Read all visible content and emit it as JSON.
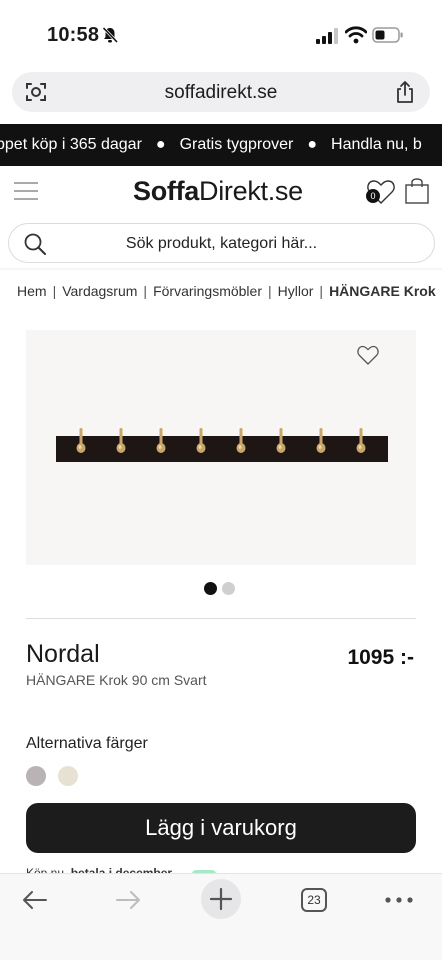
{
  "status_bar": {
    "time": "10:58"
  },
  "browser": {
    "url": "soffadirekt.se",
    "tab_count": "23"
  },
  "promo": {
    "items": [
      "ppet köp i 365 dagar",
      "Gratis tygprover",
      "Handla nu, b"
    ]
  },
  "header": {
    "logo_bold": "Soffa",
    "logo_rest": "Direkt.se",
    "wishlist_count": "0"
  },
  "search": {
    "placeholder": "Sök produkt, kategori här..."
  },
  "breadcrumb": [
    "Hem",
    "Vardagsrum",
    "Förvaringsmöbler",
    "Hyllor",
    "HÄNGARE Krok"
  ],
  "product": {
    "name": "Nordal",
    "subtitle": "HÄNGARE Krok 90 cm Svart",
    "price": "1095 :-",
    "alt_colors_label": "Alternativa färger",
    "swatches": [
      "#b9b3b5",
      "#e7e1d3"
    ],
    "add_to_cart_label": "Lägg i varukorg",
    "image_count": 2,
    "active_image": 1
  },
  "klarna": {
    "text": "Köp nu, ",
    "bold": "betala i december"
  },
  "colors": {
    "accent": "#1c1c1c",
    "promo_bg": "#111111",
    "hook_gold": "#c9a56a",
    "klarna_green": "#a6e9c9"
  }
}
